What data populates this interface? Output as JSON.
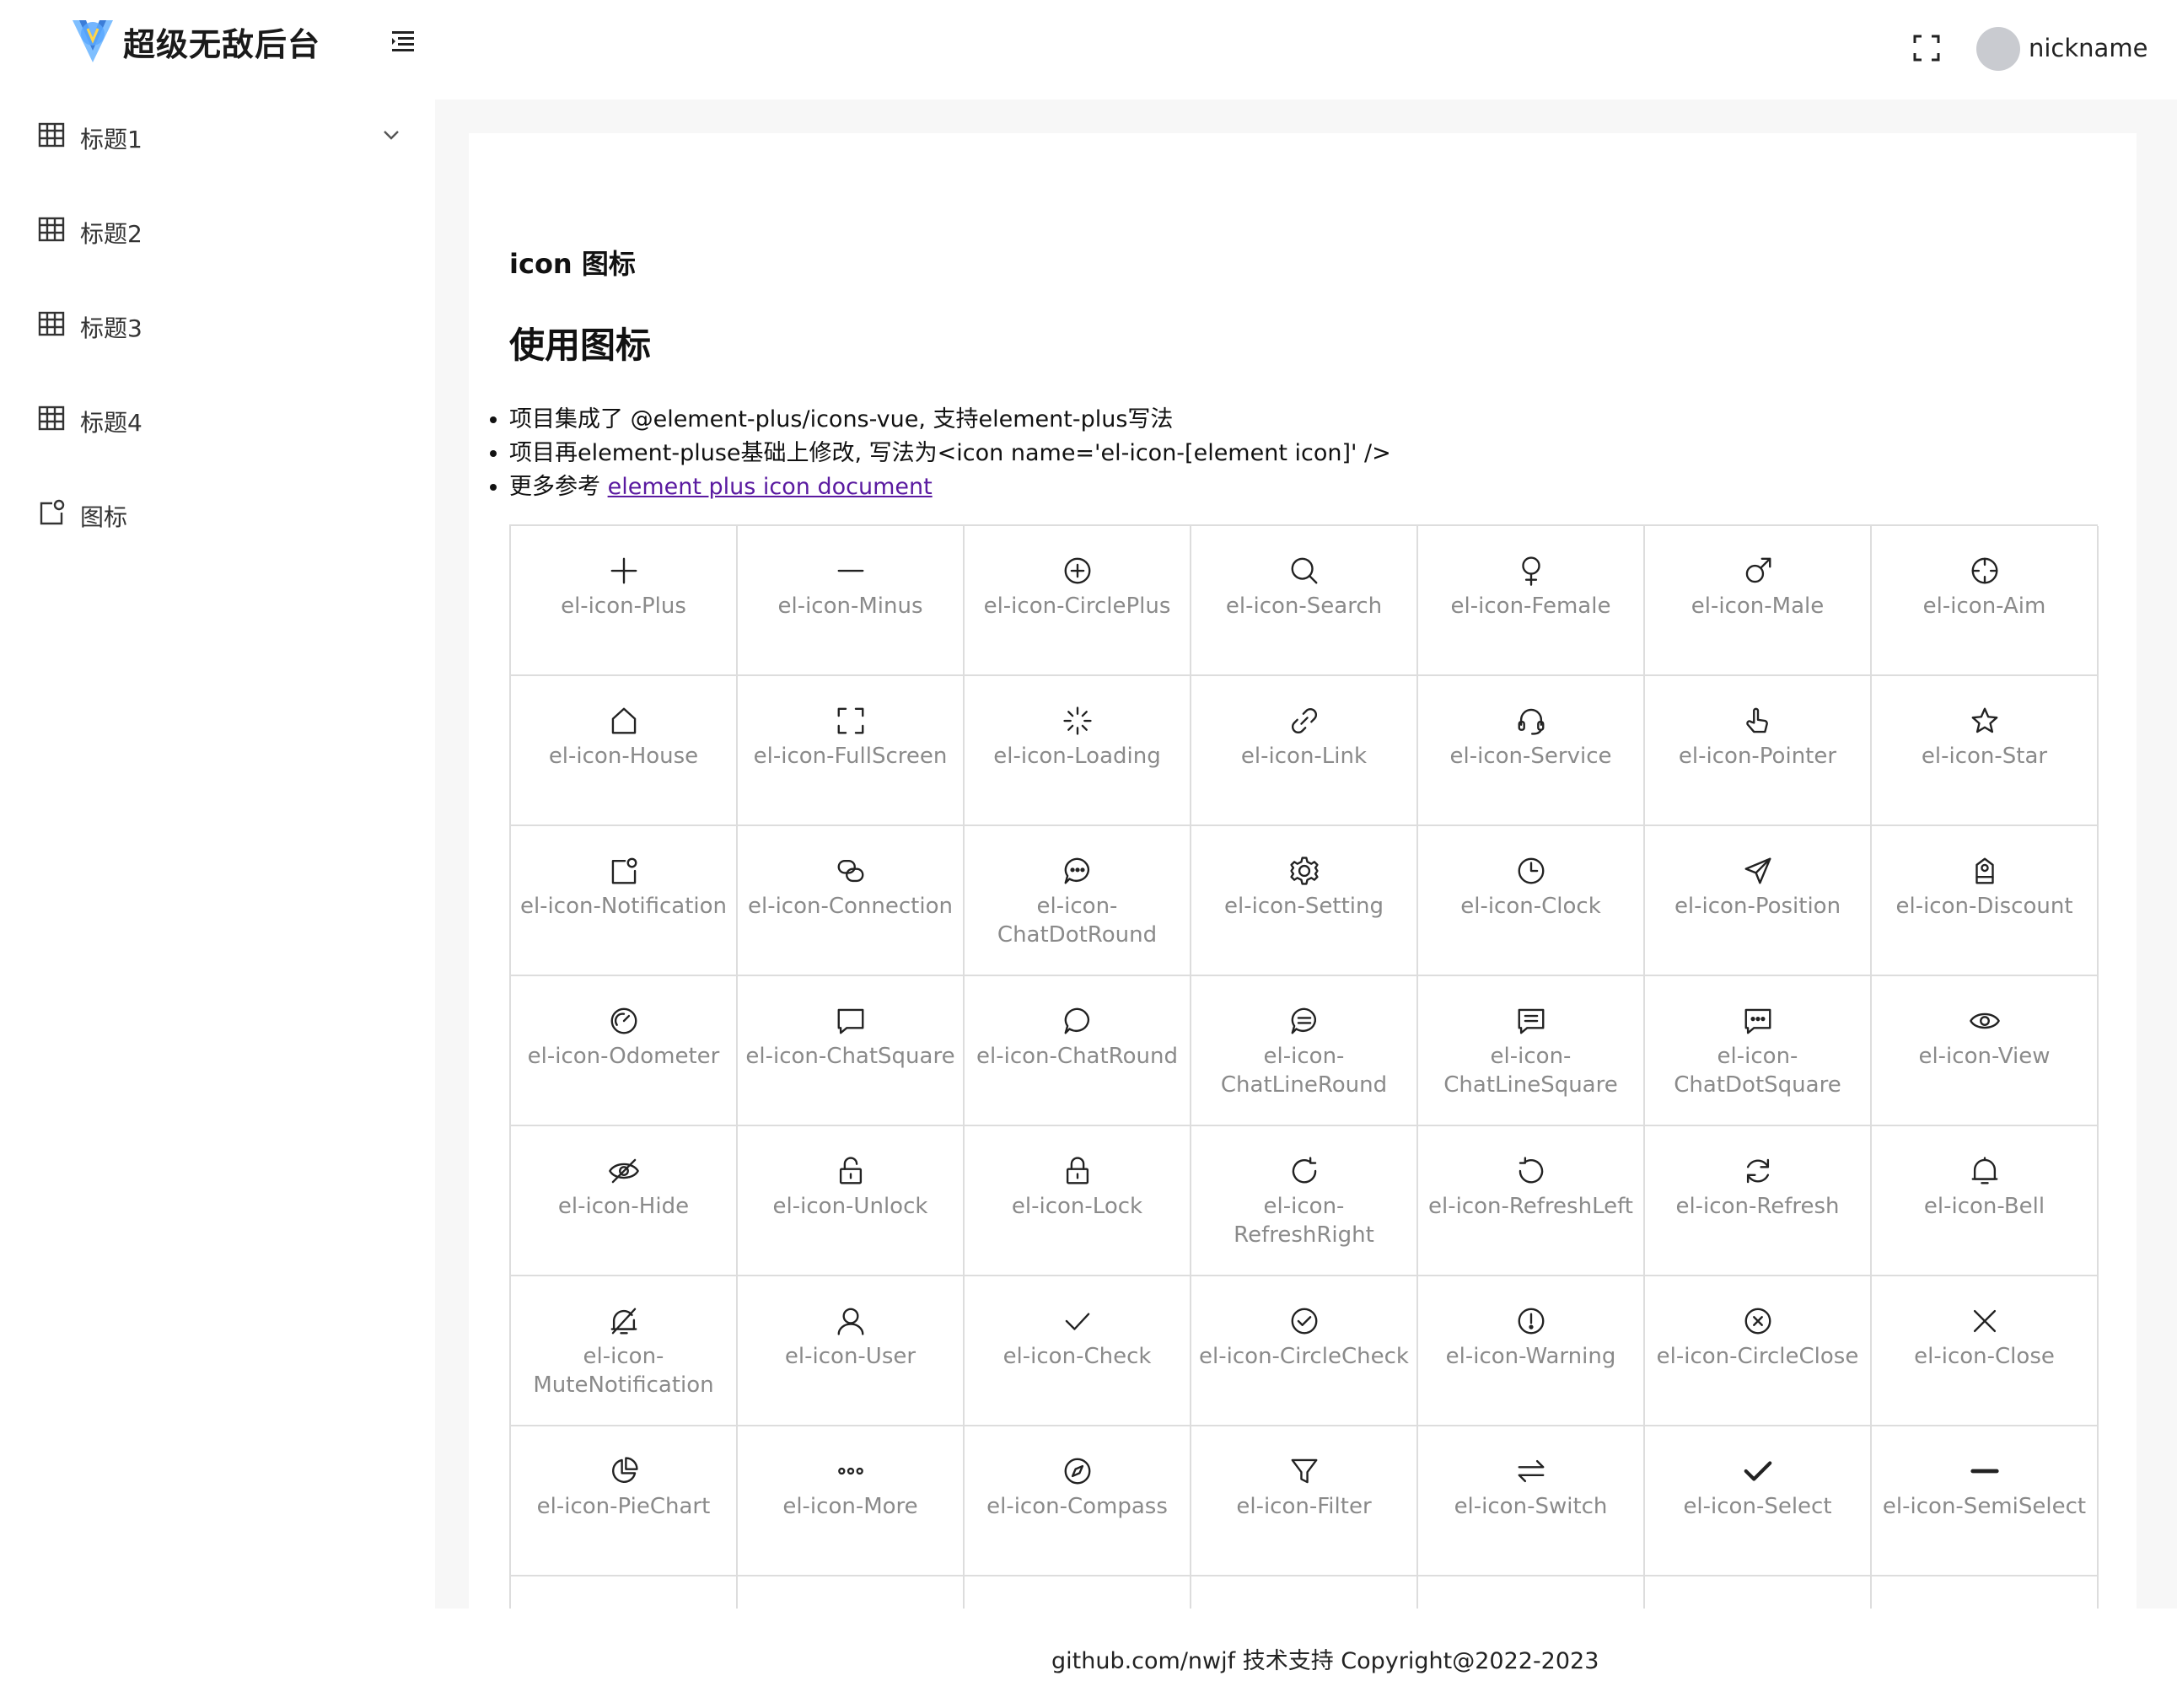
{
  "header": {
    "title": "超级无敌后台",
    "user_name": "nickname"
  },
  "sidebar": {
    "items": [
      {
        "label": "标题1",
        "icon": "table-grid-icon",
        "has_submenu": true
      },
      {
        "label": "标题2",
        "icon": "table-grid-icon"
      },
      {
        "label": "标题3",
        "icon": "table-grid-icon"
      },
      {
        "label": "标题4",
        "icon": "table-grid-icon"
      },
      {
        "label": "图标",
        "icon": "notification-icon"
      }
    ]
  },
  "content": {
    "page_title": "icon 图标",
    "section_title": "使用图标",
    "notes": [
      "项目集成了 @element-plus/icons-vue, 支持element-plus写法",
      "项目再element-pluse基础上修改, 写法为<icon name='el-icon-[element icon]' />",
      "更多参考 "
    ],
    "doc_link": "element plus icon document",
    "icons": [
      "el-icon-Plus",
      "el-icon-Minus",
      "el-icon-CirclePlus",
      "el-icon-Search",
      "el-icon-Female",
      "el-icon-Male",
      "el-icon-Aim",
      "el-icon-House",
      "el-icon-FullScreen",
      "el-icon-Loading",
      "el-icon-Link",
      "el-icon-Service",
      "el-icon-Pointer",
      "el-icon-Star",
      "el-icon-Notification",
      "el-icon-Connection",
      "el-icon-ChatDotRound",
      "el-icon-Setting",
      "el-icon-Clock",
      "el-icon-Position",
      "el-icon-Discount",
      "el-icon-Odometer",
      "el-icon-ChatSquare",
      "el-icon-ChatRound",
      "el-icon-ChatLineRound",
      "el-icon-ChatLineSquare",
      "el-icon-ChatDotSquare",
      "el-icon-View",
      "el-icon-Hide",
      "el-icon-Unlock",
      "el-icon-Lock",
      "el-icon-RefreshRight",
      "el-icon-RefreshLeft",
      "el-icon-Refresh",
      "el-icon-Bell",
      "el-icon-MuteNotification",
      "el-icon-User",
      "el-icon-Check",
      "el-icon-CircleCheck",
      "el-icon-Warning",
      "el-icon-CircleClose",
      "el-icon-Close",
      "el-icon-PieChart",
      "el-icon-More",
      "el-icon-Compass",
      "el-icon-Filter",
      "el-icon-Switch",
      "el-icon-Select",
      "el-icon-SemiSelect"
    ]
  },
  "footer": {
    "text": "github.com/nwjf 技术支持 Copyright@2022-2023"
  },
  "colors": {
    "main_bg": "#f7f7f7",
    "border": "#dddddd",
    "icon_label": "#8a8a8a",
    "link": "#5a1aa0",
    "logo_blue": "#4aa3ff"
  }
}
